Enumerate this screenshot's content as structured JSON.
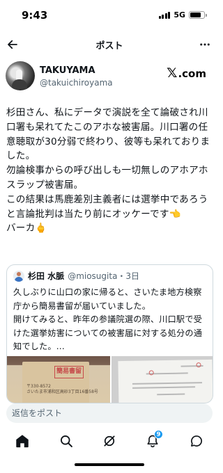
{
  "status_bar": {
    "time": "9:43",
    "network": "5G",
    "battery_level": 0.8
  },
  "header": {
    "title": "ポスト",
    "back_icon": "arrow-left-icon",
    "more_icon": "ellipsis-icon"
  },
  "author": {
    "display_name": "TAKUYAMA",
    "handle": "@takuichiroyama",
    "source_brand": "X.com",
    "source_brand_rest": ".com"
  },
  "post": {
    "text": "杉田さん、私にデータで演説を全て論破され川口署も呆れてたこのアホな被害届。川口署の任意聴取が30分弱で終わり、彼等も呆れておりました。\n勿論検事からの呼び出しも一切無しのアホアホスラップ被害届。\nこの結果は馬鹿差別主義者には選挙中であろうと言論批判は当たり前にオッケーです👈\nバーカ🖕"
  },
  "quote": {
    "name": "杉田 水脈",
    "handle_time": "@miosugita・3日",
    "text": "久しぶりに山口の家に帰ると、さいたま地方検察庁から簡易書留が届いていました。\n開けてみると、昨年の参議院選の際、川口駅で受けた選挙妨害についての被害届に対する処分の通知でした。…",
    "image1_stamp": "簡易書留",
    "image1_address": "〒330-8572\nさいたま市浦和区高砂3丁目16番58号"
  },
  "reply": {
    "placeholder": "返信をポスト"
  },
  "tabs": [
    {
      "icon": "home-icon",
      "active": true
    },
    {
      "icon": "search-icon",
      "active": false
    },
    {
      "icon": "grok-icon",
      "active": false
    },
    {
      "icon": "notifications-icon",
      "active": false,
      "badge": "9"
    },
    {
      "icon": "messages-icon",
      "active": false
    }
  ]
}
